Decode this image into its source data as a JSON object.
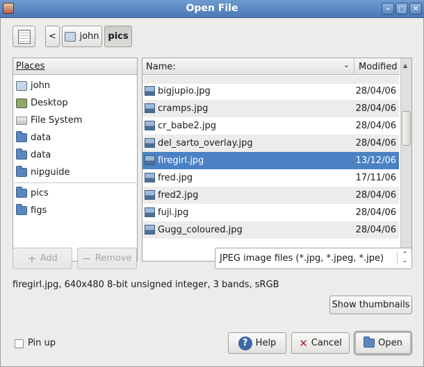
{
  "window": {
    "title": "Open File"
  },
  "toolbar": {
    "back_label": "<"
  },
  "path": [
    {
      "label": "john",
      "icon": "home-folder-icon"
    },
    {
      "label": "pics",
      "active": true
    }
  ],
  "places": {
    "header": "Places",
    "items": [
      {
        "label": "john",
        "icon": "home-folder-icon"
      },
      {
        "label": "Desktop",
        "icon": "desktop-icon"
      },
      {
        "label": "File System",
        "icon": "drive-icon"
      },
      {
        "label": "data",
        "icon": "folder-icon"
      },
      {
        "label": "data",
        "icon": "folder-icon"
      },
      {
        "label": "nipguide",
        "icon": "folder-icon"
      }
    ],
    "bookmarks": [
      {
        "label": "pics",
        "icon": "folder-icon"
      },
      {
        "label": "figs",
        "icon": "folder-icon"
      }
    ],
    "add_label": "Add",
    "remove_label": "Remove"
  },
  "files": {
    "col_name": "Name:",
    "col_modified": "Modified",
    "rows": [
      {
        "name": "bigjupio.jpg",
        "modified": "28/04/06"
      },
      {
        "name": "cramps.jpg",
        "modified": "28/04/06"
      },
      {
        "name": "cr_babe2.jpg",
        "modified": "28/04/06"
      },
      {
        "name": "del_sarto_overlay.jpg",
        "modified": "28/04/06"
      },
      {
        "name": "firegirl.jpg",
        "modified": "13/12/06",
        "selected": true
      },
      {
        "name": "fred.jpg",
        "modified": "17/11/06"
      },
      {
        "name": "fred2.jpg",
        "modified": "28/04/06"
      },
      {
        "name": "fuji.jpg",
        "modified": "28/04/06"
      },
      {
        "name": "Gugg_coloured.jpg",
        "modified": "28/04/06"
      }
    ]
  },
  "filter": {
    "value": "JPEG image files (*.jpg, *.jpeg, *.jpe)"
  },
  "status": "firegirl.jpg, 640x480 8-bit unsigned integer, 3 bands, sRGB",
  "show_thumbnails_label": "Show thumbnails",
  "pin_up_label": "Pin up",
  "buttons": {
    "help": "Help",
    "cancel": "Cancel",
    "open": "Open"
  },
  "colors": {
    "selection": "#4a82c4",
    "titlebar": "#5a86c0"
  }
}
